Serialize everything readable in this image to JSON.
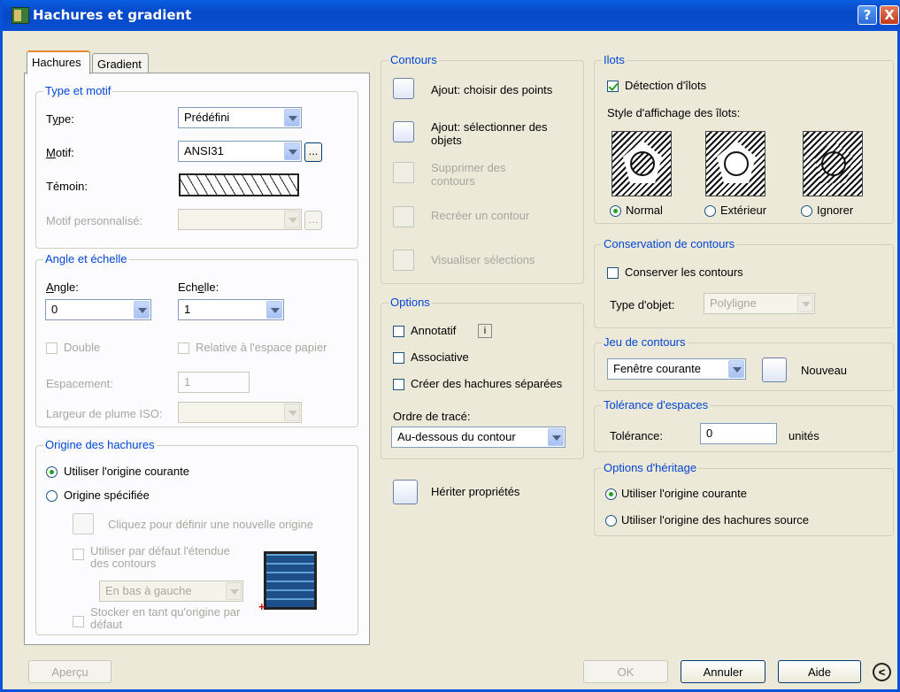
{
  "window": {
    "title": "Hachures et gradient",
    "help": "?",
    "close": "X"
  },
  "tabs": {
    "hachures": "Hachures",
    "gradient": "Gradient"
  },
  "type_motif": {
    "group": "Type et motif",
    "type_label": "Type:",
    "type_value": "Prédéfini",
    "motif_label": "Motif:",
    "motif_value": "ANSI31",
    "browse": "...",
    "temoin_label": "Témoin:",
    "motif_perso_label": "Motif personnalisé:",
    "browse2": "..."
  },
  "angle_echelle": {
    "group": "Angle et échelle",
    "angle_label": "Angle:",
    "angle_value": "0",
    "echelle_label": "Echelle:",
    "echelle_value": "1",
    "double": "Double",
    "relative": "Relative à l'espace papier",
    "espacement_label": "Espacement:",
    "espacement_value": "1",
    "largeur_label": "Largeur de plume ISO:"
  },
  "origine": {
    "group": "Origine des hachures",
    "courante": "Utiliser l'origine courante",
    "specifiee": "Origine spécifiée",
    "cliquez": "Cliquez pour définir une nouvelle origine",
    "defaut_etendue": "Utiliser par défaut l'étendue des contours",
    "position_value": "En bas à gauche",
    "stocker": "Stocker en tant qu'origine par défaut"
  },
  "contours": {
    "group": "Contours",
    "points": "Ajout: choisir des points",
    "objets": "Ajout: sélectionner des objets",
    "supprimer": "Supprimer des contours",
    "recreer": "Recréer un contour",
    "visualiser": "Visualiser sélections"
  },
  "options": {
    "group": "Options",
    "annotatif": "Annotatif",
    "associative": "Associative",
    "separees": "Créer des hachures séparées",
    "ordre_label": "Ordre de tracé:",
    "ordre_value": "Au-dessous du contour"
  },
  "heriter": {
    "label": "Hériter propriétés"
  },
  "ilots": {
    "group": "Ilots",
    "detection": "Détection d'îlots",
    "style_label": "Style d'affichage des îlots:",
    "normal": "Normal",
    "exterieur": "Extérieur",
    "ignorer": "Ignorer"
  },
  "conservation": {
    "group": "Conservation de contours",
    "conserver": "Conserver les contours",
    "type_label": "Type d'objet:",
    "type_value": "Polyligne"
  },
  "jeu": {
    "group": "Jeu de contours",
    "value": "Fenêtre courante",
    "nouveau": "Nouveau"
  },
  "tolerance": {
    "group": "Tolérance d'espaces",
    "label": "Tolérance:",
    "value": "0",
    "unit": "unités"
  },
  "heritage": {
    "group": "Options d'héritage",
    "courante": "Utiliser l'origine courante",
    "source": "Utiliser l'origine des hachures source"
  },
  "footer": {
    "apercu": "Aperçu",
    "ok": "OK",
    "annuler": "Annuler",
    "aide": "Aide",
    "more": "<"
  },
  "colors": {
    "title": "#0548c8",
    "group_label": "#0046d5",
    "dialog_bg": "#ece9d8",
    "check": "#21a121"
  }
}
